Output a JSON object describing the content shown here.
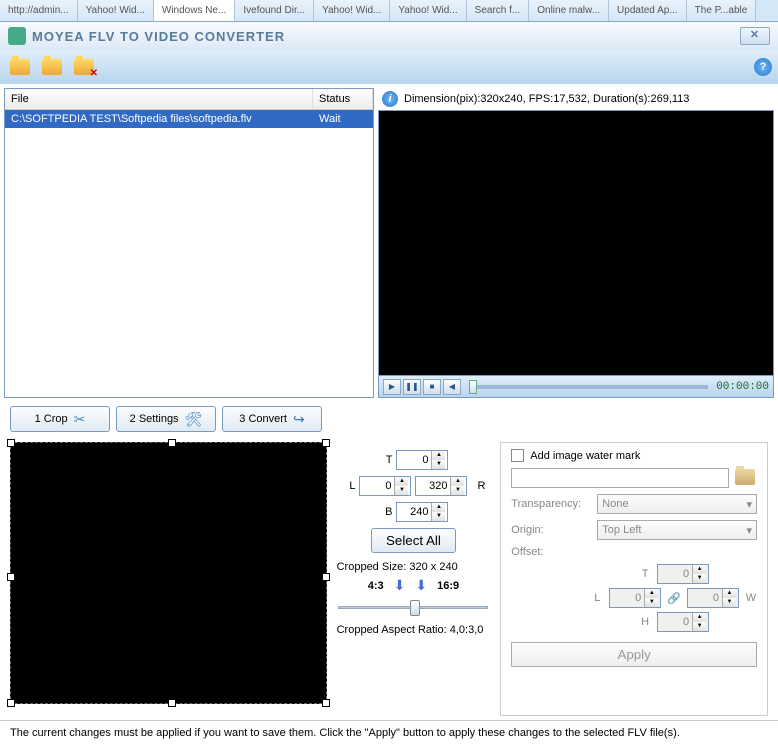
{
  "tabs": [
    "http://admin...",
    "Yahoo! Wid...",
    "Windows Ne...",
    "Ivefound Dir...",
    "Yahoo! Wid...",
    "Yahoo! Wid...",
    "Search f...",
    "Online malw...",
    "Updated Ap...",
    "The P...able"
  ],
  "title": "MOYEA FLV TO VIDEO CONVERTER",
  "list": {
    "col_file": "File",
    "col_status": "Status",
    "rows": [
      {
        "file": "C:\\SOFTPEDIA TEST\\Softpedia files\\softpedia.flv",
        "status": "Wait"
      }
    ]
  },
  "info": {
    "dim_label": "Dimension(pix):",
    "dim": "320x240",
    "fps_label": "FPS:",
    "fps": "17,532",
    "dur_label": "Duration(s):",
    "dur": "269,113"
  },
  "playbar": {
    "time": "00:00:00"
  },
  "steps": {
    "crop": "1 Crop",
    "settings": "2 Settings",
    "convert": "3 Convert"
  },
  "crop": {
    "T": "0",
    "L": "0",
    "R": "320",
    "B": "240",
    "T_label": "T",
    "L_label": "L",
    "R_label": "R",
    "B_label": "B",
    "select_all": "Select All",
    "size_label": "Cropped Size: 320 x 240",
    "ratio_43": "4:3",
    "ratio_169": "16:9",
    "aspect_label": "Cropped Aspect Ratio: 4,0:3,0"
  },
  "watermark": {
    "add_label": "Add image water mark",
    "transparency_label": "Transparency:",
    "transparency_value": "None",
    "origin_label": "Origin:",
    "origin_value": "Top Left",
    "offset_label": "Offset:",
    "T": "0",
    "L": "0",
    "W": "0",
    "H": "0",
    "T_label": "T",
    "L_label": "L",
    "W_label": "W",
    "H_label": "H",
    "apply": "Apply"
  },
  "footer": "The current changes must be applied if you want to save them. Click the \"Apply\" button to apply these changes to the selected FLV file(s)."
}
